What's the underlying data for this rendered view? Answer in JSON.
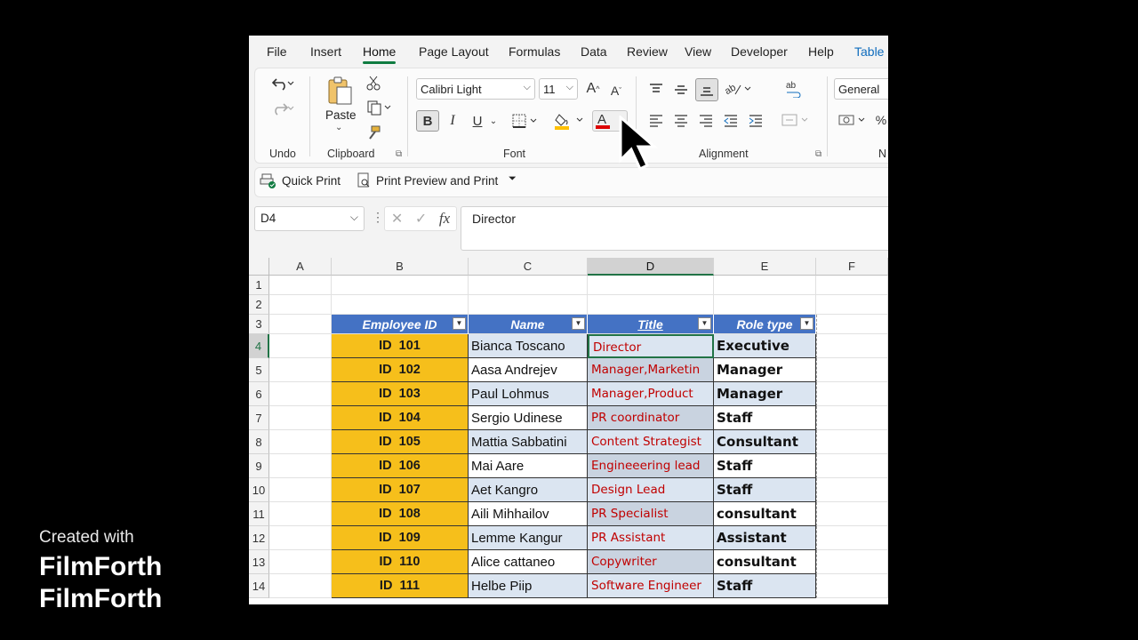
{
  "menu": {
    "tabs": [
      "File",
      "Insert",
      "Home",
      "Page Layout",
      "Formulas",
      "Data",
      "Review",
      "View",
      "Developer",
      "Help",
      "Table"
    ],
    "active": "Home"
  },
  "ribbon": {
    "undo_label": "Undo",
    "paste_label": "Paste",
    "clipboard_label": "Clipboard",
    "font_name": "Calibri Light",
    "font_size": "11",
    "font_label": "Font",
    "alignment_label": "Alignment",
    "number_format": "General",
    "number_label": "N",
    "grow_font": "A",
    "shrink_font": "A",
    "bold": "B",
    "italic": "I",
    "underline": "U",
    "font_color_glyph": "A"
  },
  "qat": {
    "quick_print": "Quick Print",
    "print_preview": "Print Preview and Print"
  },
  "formula_bar": {
    "name_box": "D4",
    "fx": "fx",
    "content": "Director"
  },
  "sheet": {
    "columns": [
      "A",
      "B",
      "C",
      "D",
      "E",
      "F"
    ],
    "selected_column": "D",
    "row_numbers": [
      "1",
      "2",
      "3",
      "4",
      "5",
      "6",
      "7",
      "8",
      "9",
      "10",
      "11",
      "12",
      "13",
      "14"
    ],
    "table_headers": {
      "id": "Employee ID",
      "name": "Name",
      "title": "Title",
      "role": "Role type"
    },
    "rows": [
      {
        "id": "ID  101",
        "name": "Bianca Toscano",
        "title": "Director",
        "role": "Executive"
      },
      {
        "id": "ID  102",
        "name": "Aasa Andrejev",
        "title": "Manager,Marketin",
        "role": "Manager"
      },
      {
        "id": "ID  103",
        "name": "Paul Lohmus",
        "title": "Manager,Product",
        "role": "Manager"
      },
      {
        "id": "ID  104",
        "name": "Sergio Udinese",
        "title": "PR coordinator",
        "role": "Staff"
      },
      {
        "id": "ID  105",
        "name": "Mattia Sabbatini",
        "title": "Content Strategist",
        "role": "Consultant"
      },
      {
        "id": "ID  106",
        "name": "Mai Aare",
        "title": "Engineeering lead",
        "role": "Staff"
      },
      {
        "id": "ID  107",
        "name": "Aet Kangro",
        "title": "Design Lead",
        "role": "Staff"
      },
      {
        "id": "ID  108",
        "name": "Aili Mihhailov",
        "title": "PR Specialist",
        "role": "consultant"
      },
      {
        "id": "ID  109",
        "name": "Lemme Kangur",
        "title": "PR Assistant",
        "role": "Assistant"
      },
      {
        "id": "ID  110",
        "name": "Alice cattaneo",
        "title": "Copywriter",
        "role": "consultant"
      },
      {
        "id": "ID  111",
        "name": "Helbe Piip",
        "title": "Software Engineer",
        "role": "Staff"
      }
    ]
  },
  "watermark": {
    "line1": "Created with",
    "line2": "FilmForth",
    "line3": "FilmForth"
  },
  "colors": {
    "accent": "#107c41",
    "table_header": "#4472c4",
    "id_fill": "#f6bf1b",
    "title_text": "#c00000"
  }
}
